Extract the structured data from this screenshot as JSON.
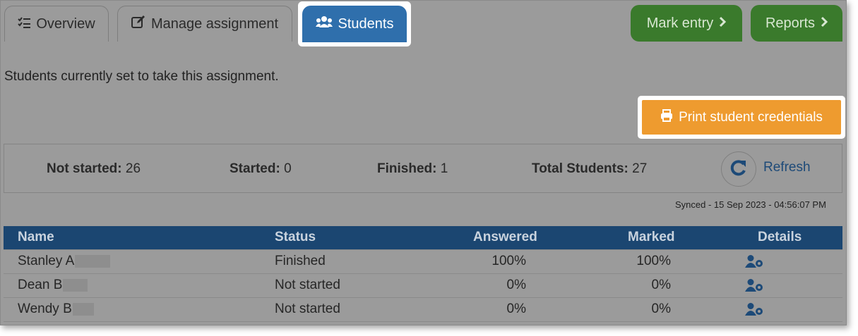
{
  "tabs": {
    "overview": "Overview",
    "manage": "Manage assignment",
    "students": "Students"
  },
  "actions": {
    "mark_entry": "Mark entry",
    "reports": "Reports",
    "print": "Print student credentials",
    "refresh": "Refresh"
  },
  "intro": "Students currently set to take this assignment.",
  "stats": {
    "not_started_label": "Not started:",
    "not_started": "26",
    "started_label": "Started:",
    "started": "0",
    "finished_label": "Finished:",
    "finished": "1",
    "total_label": "Total Students:",
    "total": "27"
  },
  "synced": "Synced - 15 Sep 2023 - 04:56:07 PM",
  "table": {
    "headers": {
      "name": "Name",
      "status": "Status",
      "answered": "Answered",
      "marked": "Marked",
      "details": "Details"
    },
    "rows": [
      {
        "name": "Stanley A",
        "status": "Finished",
        "answered": "100%",
        "marked": "100%"
      },
      {
        "name": "Dean B",
        "status": "Not started",
        "answered": "0%",
        "marked": "0%"
      },
      {
        "name": "Wendy B",
        "status": "Not started",
        "answered": "0%",
        "marked": "0%"
      }
    ]
  },
  "colors": {
    "primary_tab": "#2f6fac",
    "green": "#3a7a2c",
    "orange": "#ee9b2f",
    "table_header": "#1b4671"
  },
  "icons": [
    "checklist-icon",
    "edit-icon",
    "users-icon",
    "chevron-right-icon",
    "print-icon",
    "refresh-icon",
    "user-cog-icon"
  ]
}
